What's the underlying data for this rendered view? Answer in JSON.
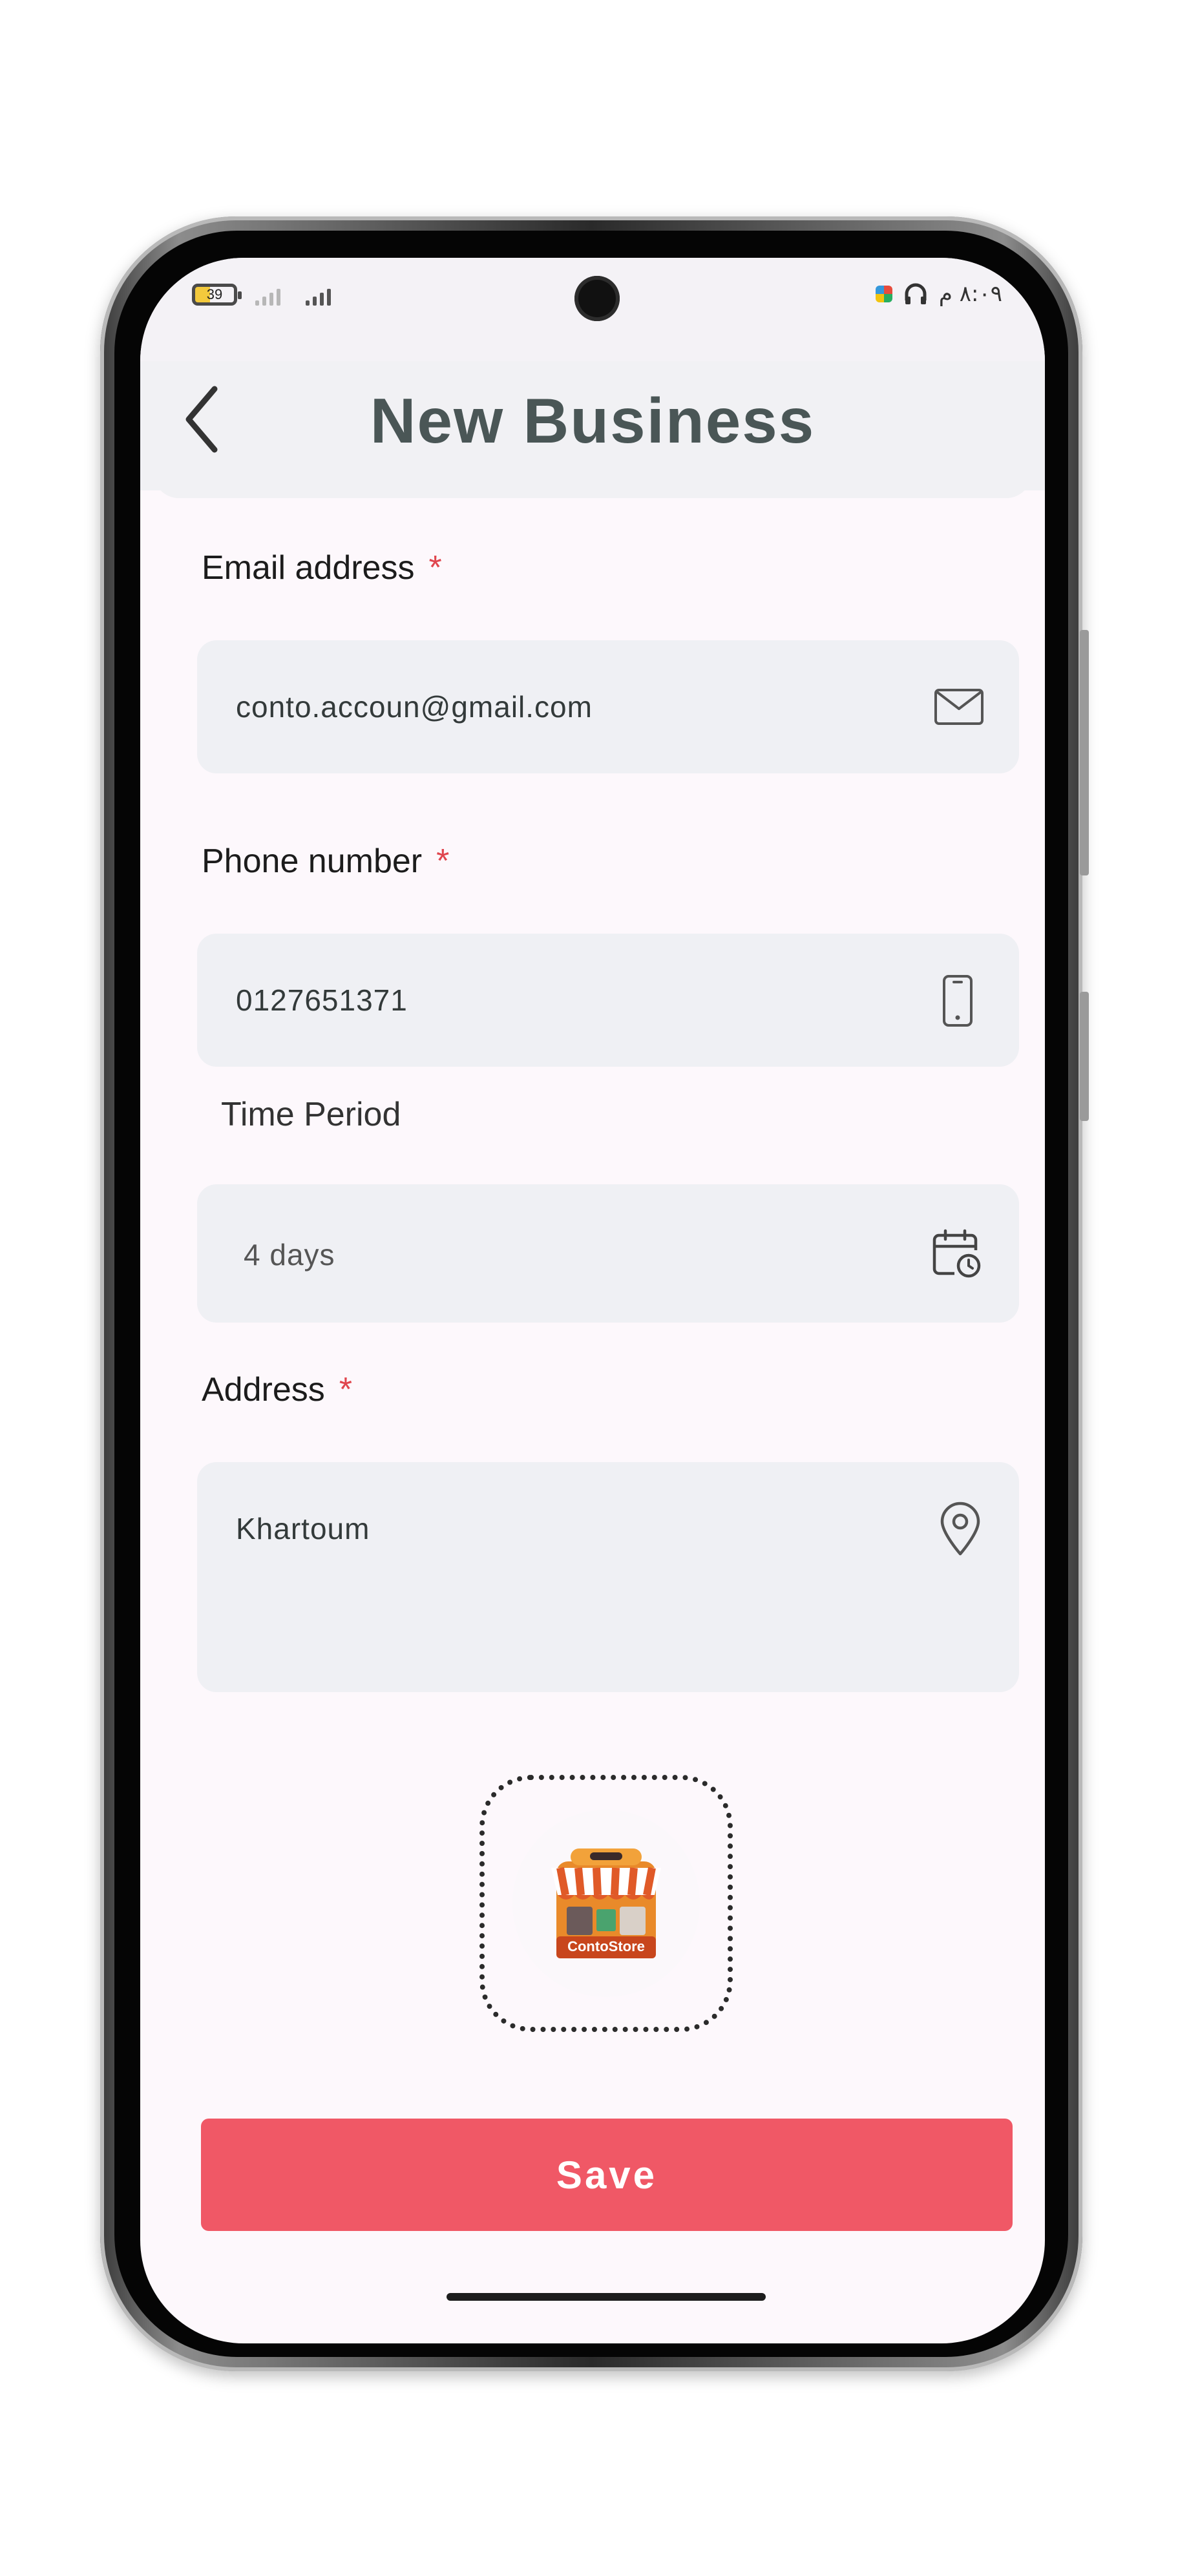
{
  "status_bar": {
    "battery_level": "39",
    "time": "٨:٠٩ م"
  },
  "header": {
    "title": "New Business",
    "back_icon": "chevron-left-icon"
  },
  "form": {
    "email": {
      "label": "Email address",
      "required_mark": "*",
      "value": "conto.accoun@gmail.com",
      "icon": "envelope-icon"
    },
    "phone": {
      "label": "Phone number",
      "required_mark": "*",
      "value": "0127651371",
      "icon": "phone-icon"
    },
    "time_period": {
      "label": "Time Period",
      "value": "4 days",
      "icon": "calendar-clock-icon"
    },
    "address": {
      "label": "Address",
      "required_mark": "*",
      "value": "Khartoum",
      "icon": "location-pin-icon"
    }
  },
  "logo": {
    "brand_text": "ContoStore",
    "icon": "store-logo-icon"
  },
  "actions": {
    "save_label": "Save"
  },
  "colors": {
    "accent": "#f05866",
    "required": "#e0464e",
    "field_bg": "#eff0f4",
    "title": "#4a5656"
  }
}
